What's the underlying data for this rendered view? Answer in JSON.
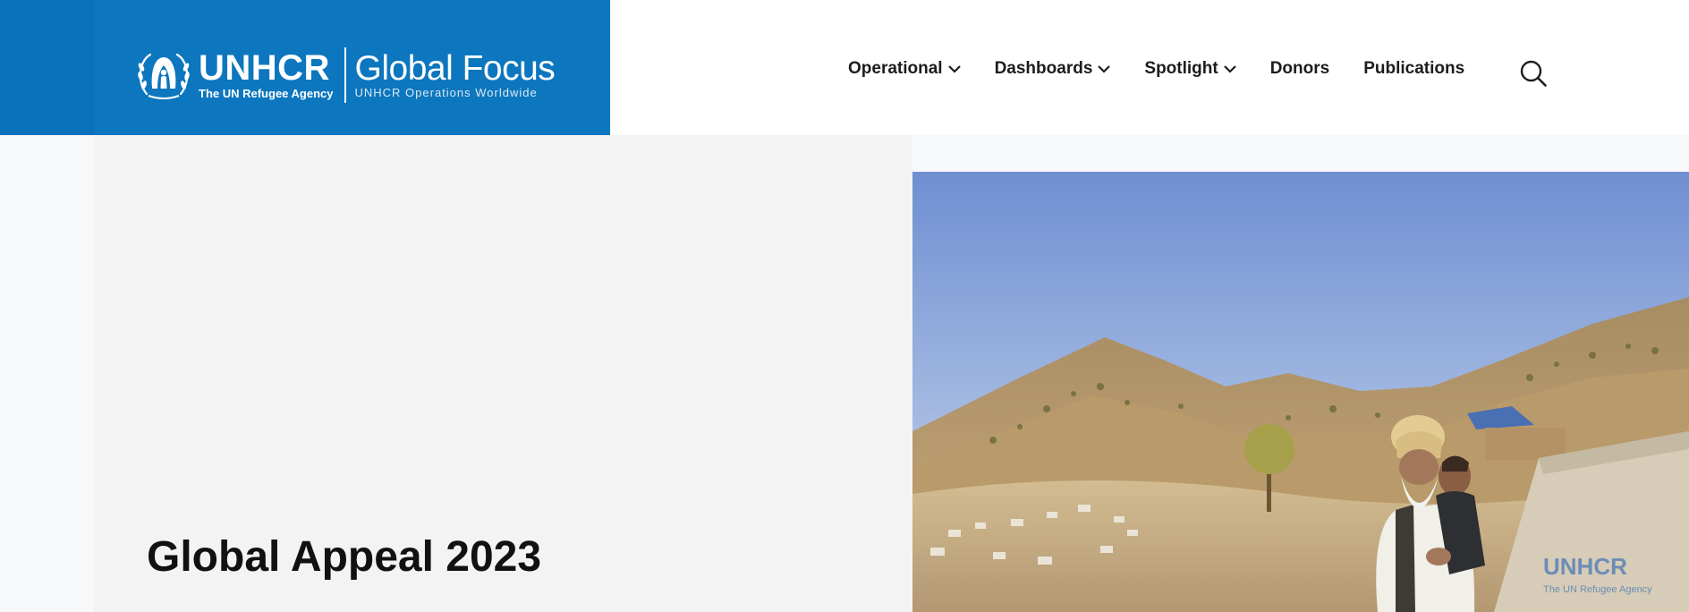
{
  "brand": {
    "org_name": "UNHCR",
    "org_tagline": "The UN Refugee Agency",
    "site_name": "Global Focus",
    "site_tagline": "UNHCR Operations Worldwide"
  },
  "nav": {
    "items": [
      {
        "label": "Operational",
        "has_dropdown": true
      },
      {
        "label": "Dashboards",
        "has_dropdown": true
      },
      {
        "label": "Spotlight",
        "has_dropdown": true
      },
      {
        "label": "Donors",
        "has_dropdown": false
      },
      {
        "label": "Publications",
        "has_dropdown": false
      }
    ],
    "search_icon": "search-icon"
  },
  "hero": {
    "title": "Global Appeal 2023",
    "image_tent_text": "UNHCR",
    "image_tent_subtext": "The UN Refugee Agency"
  },
  "colors": {
    "brand_blue": "#0c76be",
    "brand_blue_dark": "#0a72bd",
    "hero_bg": "#f3f3f3",
    "text_dark": "#1c1c1c"
  }
}
